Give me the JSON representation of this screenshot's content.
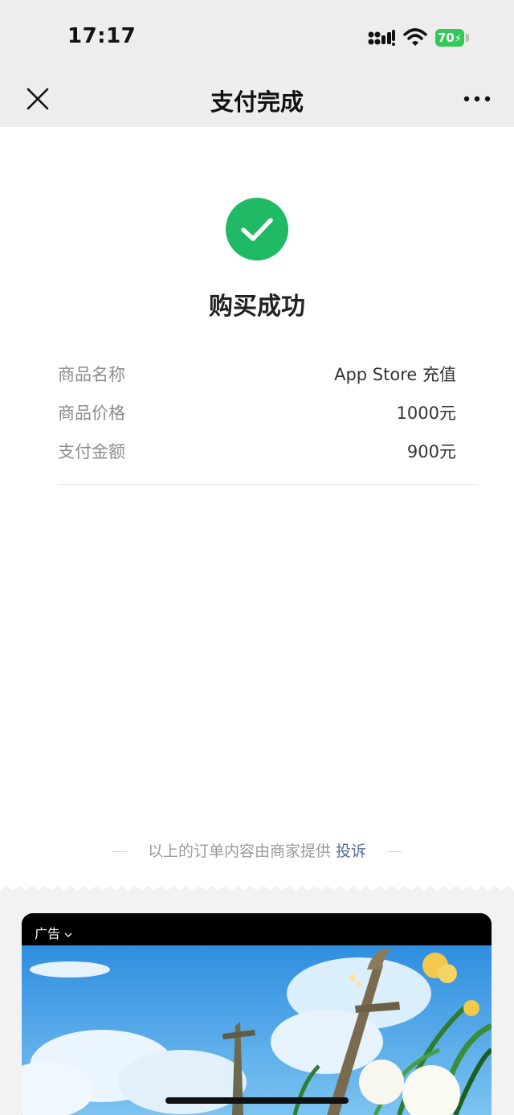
{
  "status_bar": {
    "time": "17:17",
    "battery": "70"
  },
  "nav": {
    "title": "支付完成"
  },
  "result": {
    "title": "购买成功"
  },
  "details": [
    {
      "label": "商品名称",
      "value": "App Store 充值"
    },
    {
      "label": "商品价格",
      "value": "1000元"
    },
    {
      "label": "支付金额",
      "value": "900元"
    }
  ],
  "footer": {
    "note": "以上的订单内容由商家提供",
    "link": "投诉"
  },
  "ad": {
    "label": "广告"
  },
  "colors": {
    "success": "#20b966",
    "link": "#576b95",
    "battery": "#34c759"
  }
}
